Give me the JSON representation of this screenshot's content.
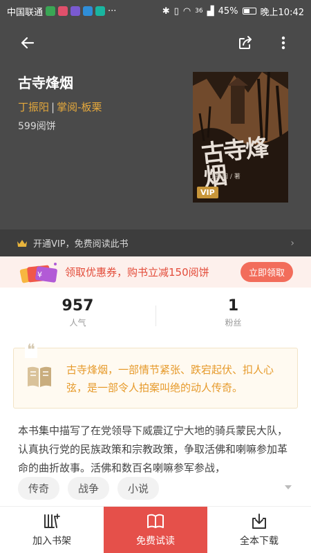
{
  "status": {
    "carrier": "中国联通",
    "dots": "···",
    "signal": "36",
    "battery": "45%",
    "time": "晚上10:42"
  },
  "header": {
    "title": "古寺烽烟",
    "author": "丁振阳",
    "separator": "|",
    "publisher": "掌阅-板栗",
    "price": "599阅饼",
    "cover_title": "古寺烽烟",
    "cover_author": "丁振阳 / 著",
    "cover_badge": "VIP"
  },
  "vip_bar": {
    "text": "开通VIP，免费阅读此书",
    "arrow": "›"
  },
  "coupon": {
    "text": "领取优惠券，购书立减150阅饼",
    "button": "立即领取"
  },
  "stats": [
    {
      "value": "957",
      "label": "人气"
    },
    {
      "value": "1",
      "label": "粉丝"
    }
  ],
  "quote": {
    "mark": "❝",
    "text": "古寺烽烟，一部情节紧张、跌宕起伏、扣人心弦，是一部令人拍案叫绝的动人传奇。"
  },
  "description": "本书集中描写了在党领导下威震辽宁大地的骑兵蒙民大队，认真执行党的民族政策和宗教政策，争取活佛和喇嘛参加革命的曲折故事。活佛和数百名喇嘛参军参战，",
  "tags": [
    "传奇",
    "战争",
    "小说"
  ],
  "bottom_bar": {
    "shelf": "加入书架",
    "read": "免费试读",
    "download": "全本下载"
  },
  "colors": {
    "header_bg": "#4a4a4a",
    "author": "#e6a93c",
    "coupon_text": "#e34c3a",
    "read_button": "#e5504a",
    "quote_text": "#e69a2b"
  }
}
